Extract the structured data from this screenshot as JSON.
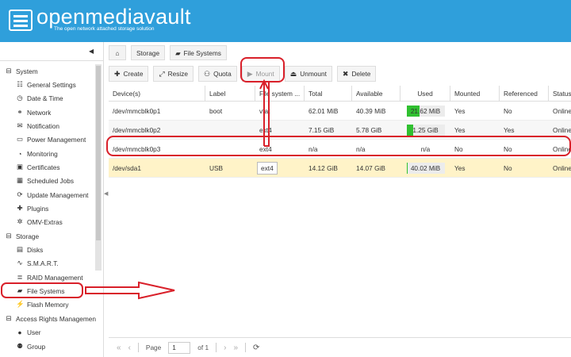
{
  "header": {
    "brand": "openmediavault",
    "tagline": "The open network attached storage solution"
  },
  "sidebar": {
    "groups": [
      {
        "label": "System",
        "icon": "minus-square-icon",
        "items": [
          {
            "label": "General Settings",
            "icon": "sliders-icon"
          },
          {
            "label": "Date & Time",
            "icon": "clock-icon"
          },
          {
            "label": "Network",
            "icon": "network-icon"
          },
          {
            "label": "Notification",
            "icon": "envelope-icon"
          },
          {
            "label": "Power Management",
            "icon": "power-icon"
          },
          {
            "label": "Monitoring",
            "icon": "monitoring-icon"
          },
          {
            "label": "Certificates",
            "icon": "certificate-icon"
          },
          {
            "label": "Scheduled Jobs",
            "icon": "calendar-icon"
          },
          {
            "label": "Update Management",
            "icon": "update-icon"
          },
          {
            "label": "Plugins",
            "icon": "puzzle-icon"
          },
          {
            "label": "OMV-Extras",
            "icon": "gears-icon"
          }
        ]
      },
      {
        "label": "Storage",
        "icon": "minus-square-icon",
        "items": [
          {
            "label": "Disks",
            "icon": "disk-icon"
          },
          {
            "label": "S.M.A.R.T.",
            "icon": "pulse-icon"
          },
          {
            "label": "RAID Management",
            "icon": "database-icon"
          },
          {
            "label": "File Systems",
            "icon": "filesystem-icon"
          },
          {
            "label": "Flash Memory",
            "icon": "lightning-icon"
          }
        ]
      },
      {
        "label": "Access Rights Managemen",
        "icon": "minus-square-icon",
        "items": [
          {
            "label": "User",
            "icon": "user-icon"
          },
          {
            "label": "Group",
            "icon": "group-icon"
          }
        ]
      }
    ]
  },
  "breadcrumb": {
    "items": [
      "Storage",
      "File Systems"
    ]
  },
  "toolbar": {
    "create": "Create",
    "resize": "Resize",
    "quota": "Quota",
    "mount": "Mount",
    "unmount": "Unmount",
    "delete": "Delete"
  },
  "grid": {
    "columns": [
      "Device(s)",
      "Label",
      "File system ...",
      "Total",
      "Available",
      "Used",
      "Mounted",
      "Referenced",
      "Status"
    ],
    "rows": [
      {
        "device": "/dev/mmcblk0p1",
        "label": "boot",
        "fs": "vfat",
        "total": "62.01 MiB",
        "available": "40.39 MiB",
        "used": "21.62 MiB",
        "used_fraction": 0.35,
        "mounted": "Yes",
        "referenced": "No",
        "status": "Online"
      },
      {
        "device": "/dev/mmcblk0p2",
        "label": "",
        "fs": "ext4",
        "total": "7.15 GiB",
        "available": "5.78 GiB",
        "used": "1.25 GiB",
        "used_fraction": 0.17,
        "mounted": "Yes",
        "referenced": "Yes",
        "status": "Online"
      },
      {
        "device": "/dev/mmcblk0p3",
        "label": "",
        "fs": "ext4",
        "total": "n/a",
        "available": "n/a",
        "used": "n/a",
        "mounted": "No",
        "referenced": "No",
        "status": "Online"
      },
      {
        "device": "/dev/sda1",
        "label": "USB",
        "fs": "ext4",
        "total": "14.12 GiB",
        "available": "14.07 GiB",
        "used": "40.02 MiB",
        "used_fraction": 0.003,
        "mounted": "Yes",
        "referenced": "No",
        "status": "Online"
      }
    ]
  },
  "pager": {
    "page_label": "Page",
    "page_value": "1",
    "of_label": "of 1"
  },
  "colors": {
    "header": "#2f9fdb",
    "annotation": "#d9202a",
    "usage_fill": "#30c030",
    "selected_row": "#fff3c8"
  }
}
